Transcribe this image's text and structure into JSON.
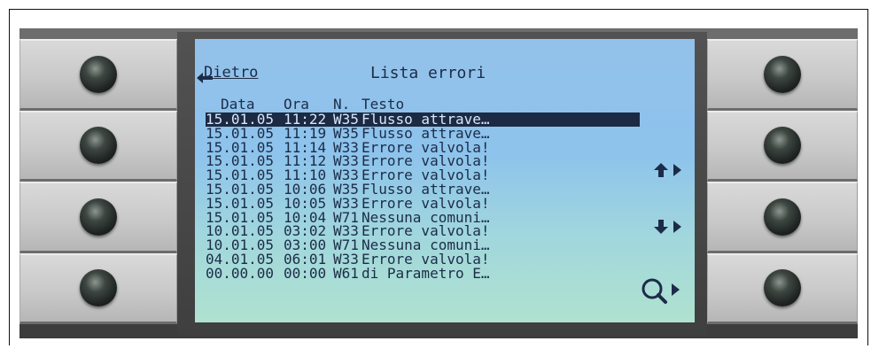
{
  "screen": {
    "back_label": "Dietro",
    "title": "Lista errori"
  },
  "columns": {
    "date": "Data",
    "time": "Ora",
    "code": "N.",
    "text": "Testo"
  },
  "rows": [
    {
      "date": "15.01.05",
      "time": "11:22",
      "code": "W35",
      "text": "Flusso attrave…",
      "selected": true
    },
    {
      "date": "15.01.05",
      "time": "11:19",
      "code": "W35",
      "text": "Flusso attrave…"
    },
    {
      "date": "15.01.05",
      "time": "11:14",
      "code": "W33",
      "text": "Errore valvola!"
    },
    {
      "date": "15.01.05",
      "time": "11:12",
      "code": "W33",
      "text": "Errore valvola!"
    },
    {
      "date": "15.01.05",
      "time": "11:10",
      "code": "W33",
      "text": "Errore valvola!"
    },
    {
      "date": "15.01.05",
      "time": "10:06",
      "code": "W35",
      "text": "Flusso attrave…"
    },
    {
      "date": "15.01.05",
      "time": "10:05",
      "code": "W33",
      "text": "Errore valvola!"
    },
    {
      "date": "15.01.05",
      "time": "10:04",
      "code": "W71",
      "text": "Nessuna comuni…"
    },
    {
      "date": "10.01.05",
      "time": "03:02",
      "code": "W33",
      "text": "Errore valvola!"
    },
    {
      "date": "10.01.05",
      "time": "03:00",
      "code": "W71",
      "text": "Nessuna comuni…"
    },
    {
      "date": "04.01.05",
      "time": "06:01",
      "code": "W33",
      "text": "Errore valvola!"
    },
    {
      "date": "00.00.00",
      "time": "00:00",
      "code": "W61",
      "text": "di Parametro E…"
    }
  ],
  "icons": {
    "back": "back-arrow-icon",
    "scroll_up": "arrow-up-icon",
    "scroll_down": "arrow-down-icon",
    "details": "magnifier-icon"
  },
  "colors": {
    "lcd_text": "#1c2c48",
    "lcd_background": "#93c1ea",
    "selection": "#1c2a44"
  }
}
